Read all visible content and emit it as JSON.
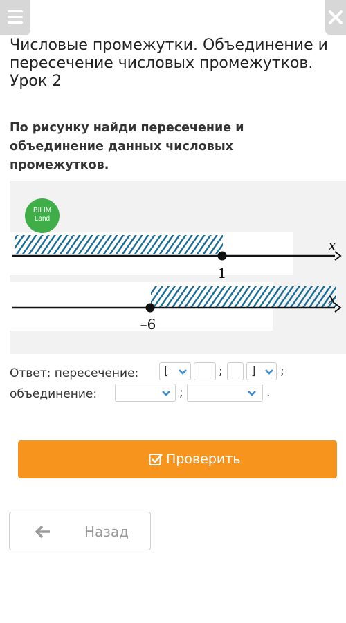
{
  "lesson": {
    "title": "Числовые промежутки. Объединение и пересечение числовых промежутков. Урок 2"
  },
  "task": {
    "text": "По рисунку найди пересечение и объединение данных числовых промежутков."
  },
  "figure": {
    "logo_line1": "BILIM",
    "logo_line2": "Land",
    "logo_color": "#3fae49",
    "hatch_color": "#1a6f9a",
    "line1": {
      "point_label": "1",
      "axis_label": "x",
      "point_value": 1,
      "shaded": "left"
    },
    "line2": {
      "point_label": "–6",
      "axis_label": "x",
      "point_value": -6,
      "shaded": "right"
    }
  },
  "answer": {
    "intersection_label": "Ответ: пересечение:",
    "union_label": "объединение:",
    "left_bracket": "[",
    "right_bracket": "]",
    "separator": ";",
    "end_period": "."
  },
  "buttons": {
    "check_label": "Проверить",
    "back_label": "Назад",
    "check_color": "#f7941e"
  },
  "icons": {
    "menu": "menu-icon",
    "close": "close-icon",
    "chevron": "chevron-down-icon",
    "check": "check-square-icon",
    "back": "arrow-left-icon"
  }
}
